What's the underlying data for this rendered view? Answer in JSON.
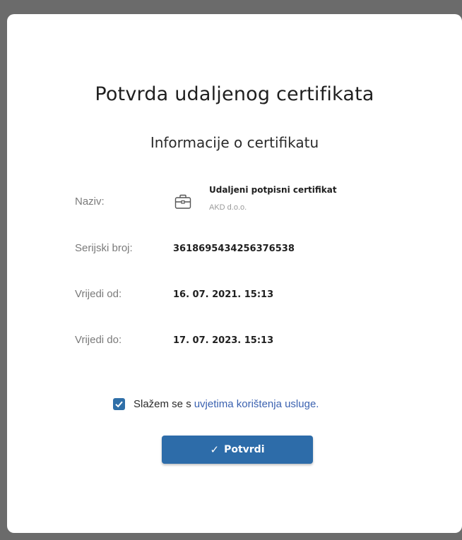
{
  "dialog": {
    "title": "Potvrda udaljenog certifikata",
    "subtitle": "Informacije o certifikatu"
  },
  "certificate": {
    "name_label": "Naziv:",
    "name": "Udaljeni potpisni certifikat",
    "issuer": "AKD d.o.o.",
    "icon": "briefcase-icon",
    "serial_label": "Serijski broj:",
    "serial": "3618695434256376538",
    "valid_from_label": "Vrijedi od:",
    "valid_from": "16. 07. 2021. 15:13",
    "valid_to_label": "Vrijedi do:",
    "valid_to": "17. 07. 2023. 15:13"
  },
  "agreement": {
    "checked": true,
    "text": "Slažem se s",
    "link": "uvjetima korištenja usluge",
    "suffix": "."
  },
  "confirm_button": {
    "icon": "check-icon",
    "label": "Potvrdi"
  },
  "colors": {
    "accent": "#2d6ca9",
    "link": "#3b62b0",
    "background_frame": "#6b6b6b"
  }
}
